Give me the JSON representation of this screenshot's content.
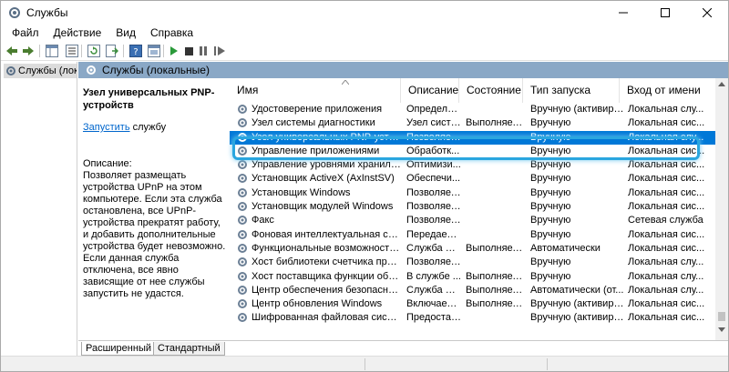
{
  "window": {
    "title": "Службы"
  },
  "menu": [
    "Файл",
    "Действие",
    "Вид",
    "Справка"
  ],
  "tree": {
    "root_label": "Службы (лок"
  },
  "band": {
    "title": "Службы (локальные)"
  },
  "description": {
    "service_name": "Узел универсальных PNP-устройств",
    "start_link": "Запустить",
    "start_suffix": " службу",
    "label": "Описание:",
    "text": "Позволяет размещать устройства UPnP на этом компьютере. Если эта служба остановлена, все UPnP-устройства прекратят работу, и добавить дополнительные устройства будет невозможно. Если данная служба отключена, все явно зависящие от нее службы запустить не удастся."
  },
  "columns": {
    "name": "Имя",
    "desc": "Описание",
    "status": "Состояние",
    "startup": "Тип запуска",
    "logon": "Вход от имени"
  },
  "rows": [
    {
      "name": "Удостоверение приложения",
      "desc": "Определя...",
      "status": "",
      "startup": "Вручную (активиро...",
      "logon": "Локальная слу..."
    },
    {
      "name": "Узел системы диагностики",
      "desc": "Узел систе...",
      "status": "Выполняется",
      "startup": "Вручную",
      "logon": "Локальная сис..."
    },
    {
      "name": "Узел универсальных PNP-устройств",
      "desc": "Позволяет...",
      "status": "",
      "startup": "Вручную",
      "logon": "Локальная слу...",
      "selected": true
    },
    {
      "name": "Управление приложениями",
      "desc": "Обработк...",
      "status": "",
      "startup": "Вручную",
      "logon": "Локальная сис..."
    },
    {
      "name": "Управление уровнями хранилища",
      "desc": "Оптимизи...",
      "status": "",
      "startup": "Вручную",
      "logon": "Локальная сис..."
    },
    {
      "name": "Установщик ActiveX (AxInstSV)",
      "desc": "Обеспечи...",
      "status": "",
      "startup": "Вручную",
      "logon": "Локальная сис..."
    },
    {
      "name": "Установщик Windows",
      "desc": "Позволяет...",
      "status": "",
      "startup": "Вручную",
      "logon": "Локальная сис..."
    },
    {
      "name": "Установщик модулей Windows",
      "desc": "Позволяет...",
      "status": "",
      "startup": "Вручную",
      "logon": "Локальная сис..."
    },
    {
      "name": "Факс",
      "desc": "Позволяет...",
      "status": "",
      "startup": "Вручную",
      "logon": "Сетевая служба"
    },
    {
      "name": "Фоновая интеллектуальная служб...",
      "desc": "Передает ...",
      "status": "",
      "startup": "Вручную",
      "logon": "Локальная сис..."
    },
    {
      "name": "Функциональные возможности дл...",
      "desc": "Служба ф...",
      "status": "Выполняется",
      "startup": "Автоматически",
      "logon": "Локальная сис..."
    },
    {
      "name": "Хост библиотеки счетчика произв...",
      "desc": "Позволяет...",
      "status": "",
      "startup": "Вручную",
      "logon": "Локальная слу..."
    },
    {
      "name": "Хост поставщика функции обнару...",
      "desc": "В службе ...",
      "status": "Выполняется",
      "startup": "Вручную",
      "logon": "Локальная слу..."
    },
    {
      "name": "Центр обеспечения безопасности",
      "desc": "Служба W...",
      "status": "Выполняется",
      "startup": "Автоматически (от...",
      "logon": "Локальная слу..."
    },
    {
      "name": "Центр обновления Windows",
      "desc": "Включает ...",
      "status": "Выполняется",
      "startup": "Вручную (активиро...",
      "logon": "Локальная сис..."
    },
    {
      "name": "Шифрованная файловая система (...",
      "desc": "Предостав...",
      "status": "",
      "startup": "Вручную (активиро...",
      "logon": "Локальная сис..."
    }
  ],
  "tabs": {
    "extended": "Расширенный",
    "standard": "Стандартный"
  },
  "colors": {
    "band": "#8aa8c6",
    "selection": "#0078d7",
    "highlight_outline": "#2aa6df",
    "link": "#0066cc"
  }
}
